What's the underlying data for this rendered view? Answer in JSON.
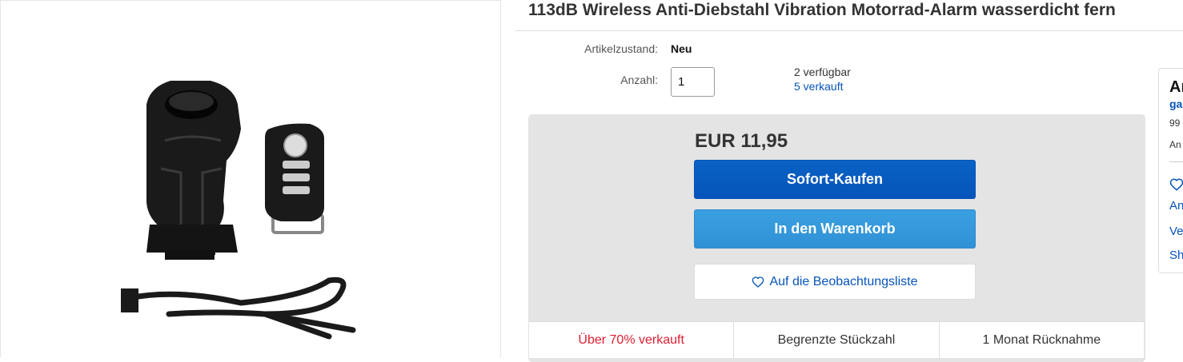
{
  "product": {
    "title": "113dB Wireless Anti-Diebstahl Vibration Motorrad-Alarm wasserdicht fern"
  },
  "details": {
    "condition_label": "Artikelzustand:",
    "condition_value": "Neu",
    "quantity_label": "Anzahl:",
    "quantity_value": "1",
    "available_text": "2 verfügbar",
    "sold_text": "5 verkauft"
  },
  "buybox": {
    "price": "EUR 11,95",
    "buy_now_label": "Sofort-Kaufen",
    "add_to_cart_label": "In den Warenkorb",
    "watchlist_label": "Auf die Beobachtungsliste"
  },
  "badges": [
    {
      "text": "Über 70% verkauft",
      "color": "#dd1e31"
    },
    {
      "text": "Begrenzte Stückzahl"
    },
    {
      "text": "1 Monat Rücknahme"
    }
  ],
  "seller_panel": {
    "heading": "An",
    "name": "ga",
    "percent": "99",
    "other": "An",
    "links": [
      "An",
      "Ve",
      "Sh"
    ]
  },
  "icons": {
    "watch": "heart-outline-icon",
    "seller_save": "heart-outline-icon"
  },
  "colors": {
    "link_blue": "#0654ba",
    "buy_button": "#0654ba",
    "cart_button": "#3091d6",
    "buybox_bg": "#e4e4e4"
  }
}
